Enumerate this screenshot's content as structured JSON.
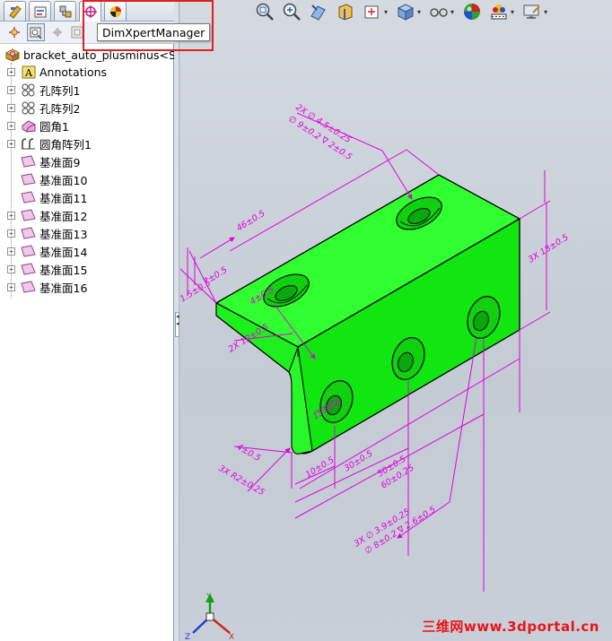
{
  "panel": {
    "tabs": [
      {
        "name": "featuremanager",
        "icon": "featuremanager-icon"
      },
      {
        "name": "propertymanager",
        "icon": "propertymanager-icon"
      },
      {
        "name": "configurationmanager",
        "icon": "configurationmanager-icon"
      },
      {
        "name": "dimxpertmanager",
        "icon": "dimxpert-icon",
        "active": true
      },
      {
        "name": "displaymanager",
        "icon": "displaymanager-icon"
      }
    ],
    "tooltip": "DimXpertManager"
  },
  "tree": {
    "root": "bracket_auto_plusminus<Scr",
    "items": [
      {
        "label": "Annotations",
        "icon": "annotations-icon",
        "expandable": true
      },
      {
        "label": "孔阵列1",
        "icon": "hole-pattern-icon",
        "expandable": true
      },
      {
        "label": "孔阵列2",
        "icon": "hole-pattern-icon",
        "expandable": true
      },
      {
        "label": "圆角1",
        "icon": "fillet-icon",
        "expandable": true
      },
      {
        "label": "圆角阵列1",
        "icon": "fillet-pattern-icon",
        "expandable": true
      },
      {
        "label": "基准面9",
        "icon": "plane-icon",
        "expandable": false
      },
      {
        "label": "基准面10",
        "icon": "plane-icon",
        "expandable": false
      },
      {
        "label": "基准面11",
        "icon": "plane-icon",
        "expandable": false
      },
      {
        "label": "基准面12",
        "icon": "plane-icon",
        "expandable": true
      },
      {
        "label": "基准面13",
        "icon": "plane-icon",
        "expandable": true
      },
      {
        "label": "基准面14",
        "icon": "plane-icon",
        "expandable": true
      },
      {
        "label": "基准面15",
        "icon": "plane-icon",
        "expandable": true
      },
      {
        "label": "基准面16",
        "icon": "plane-icon",
        "expandable": true
      }
    ]
  },
  "dimensions": {
    "top_hole_line1": "2X ∅ 4.5±0.25",
    "top_hole_line2": "∅ 9±0.2 ∇ 2±0.5",
    "length": "46±0.5",
    "width_a": "7±0.5",
    "width_b": "1.5±0.5",
    "width_c": "4±0.5",
    "lip": "2X 12±0.5",
    "right_height": "3X 18±0.5",
    "fillet": "4±0.5",
    "fillet_pattern": "3X R2±0.25",
    "side_a": "10±0.5",
    "side_b": "30±0.5",
    "side_c": "50±0.5",
    "side_d": "60±0.25",
    "side_hole_line1": "3X ∅ 3.9±0.25",
    "side_hole_line2": "∅ 8±0.2 ∇ 2.6±0.5",
    "hole_small": "15±0.5"
  },
  "triad": {
    "y": "Y",
    "x": "X",
    "z": "Z"
  },
  "watermark": "三维网www.3dportal.cn",
  "colors": {
    "part": "#22f022",
    "dimension": "#e000e0",
    "highlight": "#e02020"
  }
}
